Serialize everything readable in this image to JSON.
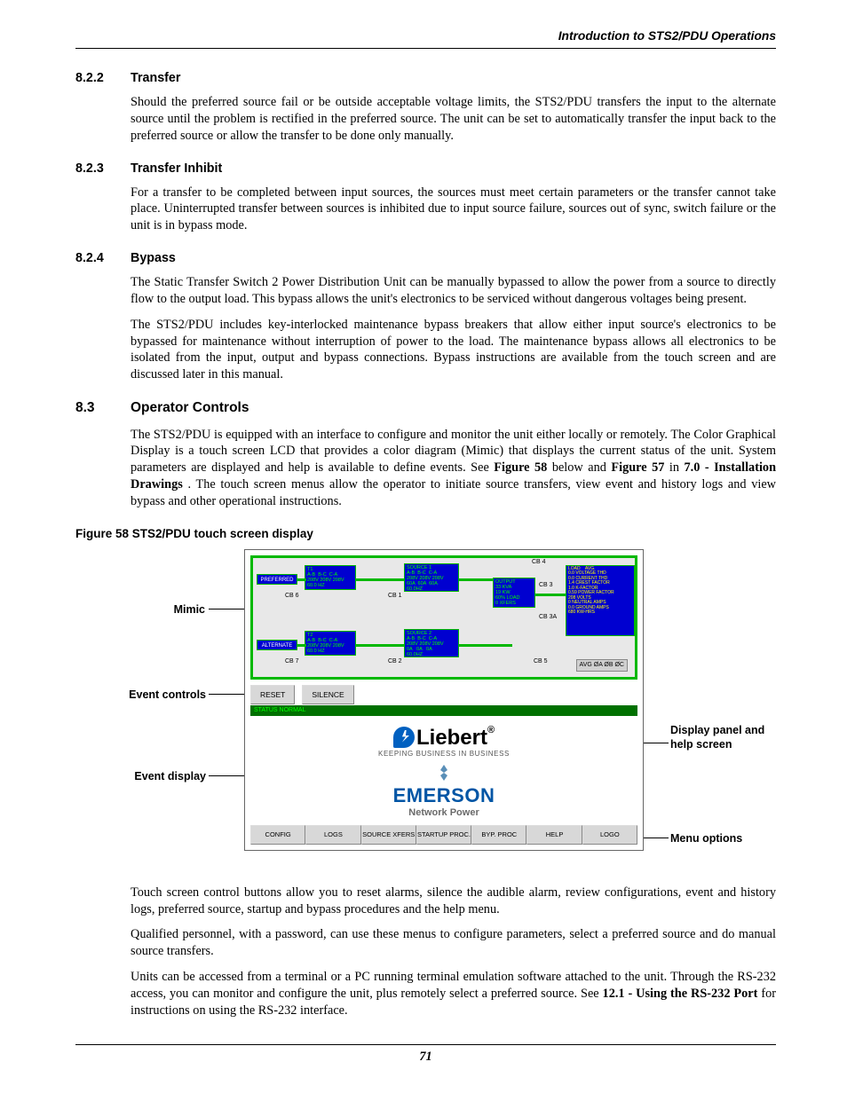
{
  "running_head": "Introduction to STS2/PDU Operations",
  "sections": {
    "s822": {
      "num": "8.2.2",
      "title": "Transfer",
      "p1": "Should the preferred source fail or be outside acceptable voltage limits, the STS2/PDU transfers the input to the alternate source until the problem is rectified in the preferred source. The unit can be set to automatically transfer the input back to the preferred source or allow the transfer to be done only manually."
    },
    "s823": {
      "num": "8.2.3",
      "title": "Transfer Inhibit",
      "p1": "For a transfer to be completed between input sources, the sources must meet certain parameters or the transfer cannot take place. Uninterrupted transfer between sources is inhibited due to input source failure, sources out of sync, switch failure or the unit is in bypass mode."
    },
    "s824": {
      "num": "8.2.4",
      "title": "Bypass",
      "p1": "The Static Transfer Switch 2 Power Distribution Unit can be manually bypassed to allow the power from a source to directly flow to the output load. This bypass allows the unit's electronics to be serviced without dangerous voltages being present.",
      "p2": "The STS2/PDU includes key-interlocked maintenance bypass breakers that allow either input source's electronics to be bypassed for maintenance without interruption of power to the load. The maintenance bypass allows all electronics to be isolated from the input, output and bypass connections. Bypass instructions are available from the touch screen and are discussed later in this manual."
    },
    "s83": {
      "num": "8.3",
      "title": "Operator Controls",
      "p1a": "The STS2/PDU is equipped with an interface to configure and monitor the unit either locally or remotely. The Color Graphical Display is a touch screen LCD that provides a color diagram (Mimic) that displays the current status of the unit. System parameters are displayed and help is available to define events. See ",
      "p1b": "Figure 58",
      "p1c": " below and ",
      "p1d": "Figure 57",
      "p1e": " in ",
      "p1f": "7.0 - Installation Drawings",
      "p1g": ". The touch screen menus allow the operator to initiate source transfers, view event and history logs and view bypass and other operational instructions."
    }
  },
  "figure": {
    "caption": "Figure 58  STS2/PDU touch screen display",
    "callouts": {
      "mimic": "Mimic",
      "event_controls": "Event controls",
      "event_display": "Event display",
      "display_panel": "Display panel and help screen",
      "menu_options": "Menu options"
    },
    "mimic_boxes": {
      "preferred": "PREFERRED",
      "alternate": "ALTERNATE",
      "t1": "T1\nA-B  B-C  C-A\n208V 208V 208V\n60.0 HZ",
      "t2": "T2\nA-B  B-C  C-A\n208V 208V 208V\n60.0 HZ",
      "source1": "SOURCE 1\nA-B  B-C  C-A\n208V 208V 208V\n60A  60A  60A\n60.0HZ",
      "source2": "SOURCE 2\nA-B  B-C  C-A\n208V 208V 208V\n0A   0A   0A\n60.0HZ",
      "output": "OUTPUT\n33 KVA\n19 KW\n60% LOAD\n0 XFERS",
      "load": "LOAD    AVG.\n0.0 VOLTAGE THD\n0.0 CURRENT THD\n1.4 CREST FACTOR\n1.0 K-FACTOR\n0.59 POWER FACTOR\n208 VOLTS\n0 NEUTRAL AMPS\n0.0 GROUND AMPS\n680 KW-HRS",
      "cb1": "CB 1",
      "cb2": "CB 2",
      "cb3": "CB 3",
      "cb3a": "CB 3A",
      "cb4": "CB 4",
      "cb5": "CB 5",
      "cb6": "CB 6",
      "cb7": "CB 7",
      "avg_btn": "AVG  ØA  ØB  ØC"
    },
    "event_buttons": {
      "reset": "RESET",
      "silence": "SILENCE"
    },
    "status_text": "STATUS NORMAL",
    "logos": {
      "liebert": "Liebert",
      "liebert_reg": "®",
      "liebert_tag": "KEEPING BUSINESS IN BUSINESS",
      "emerson": "EMERSON",
      "emerson_sub": "Network Power"
    },
    "menu": [
      "CONFIG",
      "LOGS",
      "SOURCE XFERS",
      "STARTUP PROC.",
      "BYP. PROC",
      "HELP",
      "LOGO"
    ]
  },
  "after_figure": {
    "p1": "Touch screen control buttons allow you to reset alarms, silence the audible alarm, review configurations, event and history logs, preferred source, startup and bypass procedures and the help menu.",
    "p2": "Qualified personnel, with a password, can use these menus to configure parameters, select a preferred source and do manual source transfers.",
    "p3a": "Units can be accessed from a terminal or a PC running terminal emulation software attached to the unit. Through the RS-232 access, you can monitor and configure the unit, plus remotely select a preferred source. See ",
    "p3b": "12.1 - Using the RS-232 Port",
    "p3c": " for instructions on using the RS-232 interface."
  },
  "page_number": "71"
}
